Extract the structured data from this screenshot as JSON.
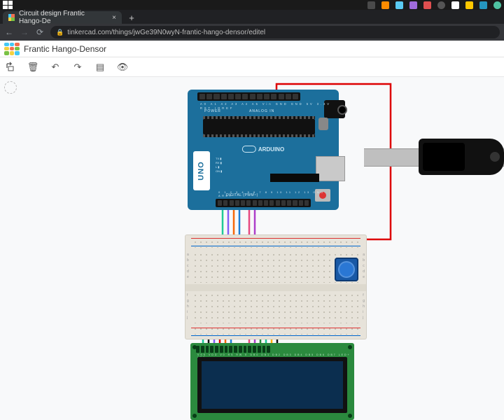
{
  "os": {
    "tray_colors": [
      "#4a4a4a",
      "#ff8c00",
      "#5acaf2",
      "#a06bdc",
      "#e04f4f",
      "#3ddc84",
      "#ffffff",
      "#ffc800",
      "#2596be",
      "#4fc3a1"
    ]
  },
  "browser": {
    "tab_title": "Circuit design Frantic Hango-De",
    "close_glyph": "×",
    "newtab_glyph": "+",
    "nav": {
      "back": "←",
      "forward": "→",
      "reload": "⟳"
    },
    "lock_glyph": "🔒",
    "url": "tinkercad.com/things/jwGe39N0wyN-frantic-hango-densor/editel"
  },
  "app": {
    "project_name": "Frantic Hango-Densor",
    "toolbar": {
      "rotate": "⟲",
      "delete": "🗑",
      "undo": "↶",
      "redo": "↷",
      "notes": "▤",
      "visibility": "👁"
    }
  },
  "arduino": {
    "power_label": "POWER",
    "analog_label": "ANALOG IN",
    "digital_label": "DIGITAL (PWM~)",
    "brand": "ARDUINO",
    "model": "UNO",
    "txrx": "TX ▮\nRX ▮\nL ▮\nON ▮",
    "analog_pins": "A0 A1 A2 A3 A4 A5  Vin GND GND 5V 3.3V RST IOREF",
    "digital_pins": "0 1 2 3 4 5 6 7  8 9 10 11 12 13 GND AREF"
  },
  "breadboard": {
    "rows_left": "a\nb\nc\nd\ne",
    "rows_left2": "f\ng\nh\ni\nj"
  },
  "lcd": {
    "pin_labels": "VSS VDD V0 RS RW E DB0 DB1 DB2 DB3 DB4 DB5 DB6 DB7 LED+ LED-"
  }
}
